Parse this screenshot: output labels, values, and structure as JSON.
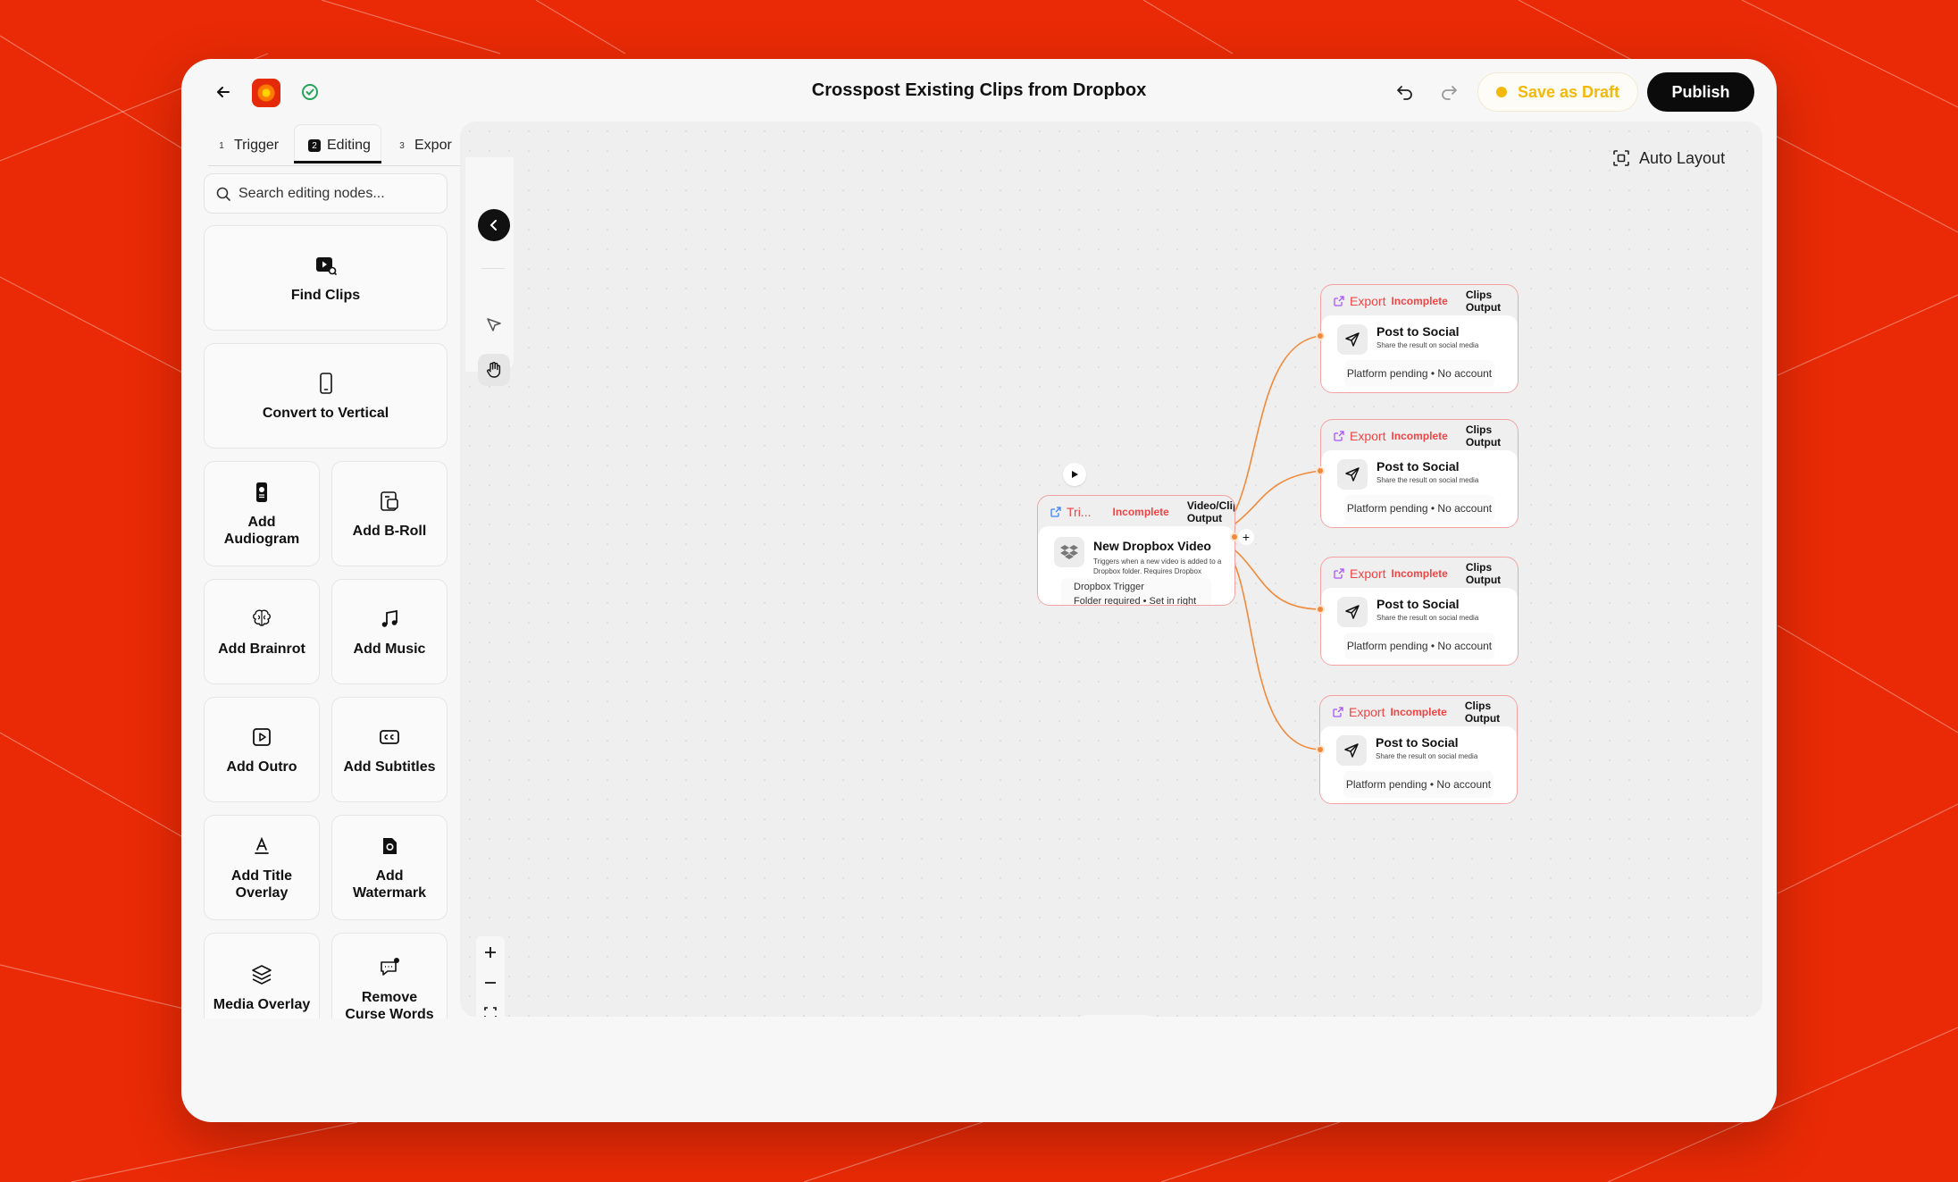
{
  "header": {
    "title": "Crosspost Existing Clips from Dropbox",
    "save_draft_label": "Save as Draft",
    "publish_label": "Publish",
    "icons": [
      "back-arrow-icon",
      "app-logo",
      "check-circle-icon",
      "undo-icon",
      "redo-icon"
    ]
  },
  "colors": {
    "background": "#ea2a06",
    "accent_orange": "#f08a3a",
    "incomplete_red": "#ef4444",
    "draft_yellow": "#f2b90c",
    "publish_black": "#0b0b0b"
  },
  "sidebar": {
    "tabs": [
      {
        "num": "1",
        "label": "Trigger"
      },
      {
        "num": "2",
        "label": "Editing",
        "active": true
      },
      {
        "num": "3",
        "label": "Expor"
      }
    ],
    "search_placeholder": "Search editing nodes...",
    "nodes": [
      {
        "label": "Find Clips",
        "icon": "video-search-icon"
      },
      {
        "label": "Convert to Vertical",
        "icon": "phone-icon"
      },
      {
        "label": "Add Audiogram",
        "icon": "audiogram-icon"
      },
      {
        "label": "Add B-Roll",
        "icon": "broll-icon"
      },
      {
        "label": "Add Brainrot",
        "icon": "brain-icon"
      },
      {
        "label": "Add Music",
        "icon": "music-icon"
      },
      {
        "label": "Add Outro",
        "icon": "play-square-icon"
      },
      {
        "label": "Add Subtitles",
        "icon": "cc-icon"
      },
      {
        "label": "Add Title Overlay",
        "icon": "text-icon"
      },
      {
        "label": "Add Watermark",
        "icon": "watermark-icon"
      },
      {
        "label": "Media Overlay",
        "icon": "layers-icon"
      },
      {
        "label": "Remove Curse Words",
        "icon": "curse-icon"
      }
    ]
  },
  "canvas": {
    "auto_layout_label": "Auto Layout",
    "trigger_node": {
      "kind": "Tri...",
      "status": "Incomplete",
      "output": "Video/Clips Output",
      "title": "New Dropbox Video",
      "description": "Triggers when a new video is added to a Dropbox folder. Requires Dropbox account verification.",
      "info_title": "Dropbox Trigger",
      "info_detail": "Folder required • Set in right panel"
    },
    "export_nodes": [
      {
        "kind": "Export",
        "status": "Incomplete",
        "output": "Clips Output",
        "title": "Post to Social",
        "description": "Share the result on social media",
        "info": "Platform pending • No account"
      },
      {
        "kind": "Export",
        "status": "Incomplete",
        "output": "Clips Output",
        "title": "Post to Social",
        "description": "Share the result on social media",
        "info": "Platform pending • No account"
      },
      {
        "kind": "Export",
        "status": "Incomplete",
        "output": "Clips Output",
        "title": "Post to Social",
        "description": "Share the result on social media",
        "info": "Platform pending • No account"
      },
      {
        "kind": "Export",
        "status": "Incomplete",
        "output": "Clips Output",
        "title": "Post to Social",
        "description": "Share the result on social media",
        "info": "Platform pending • No account"
      }
    ],
    "zoom_controls": [
      "zoom-in-icon",
      "zoom-out-icon",
      "fit-view-icon",
      "lock-icon"
    ],
    "mode_toggle": {
      "code_label": "</>"
    }
  }
}
